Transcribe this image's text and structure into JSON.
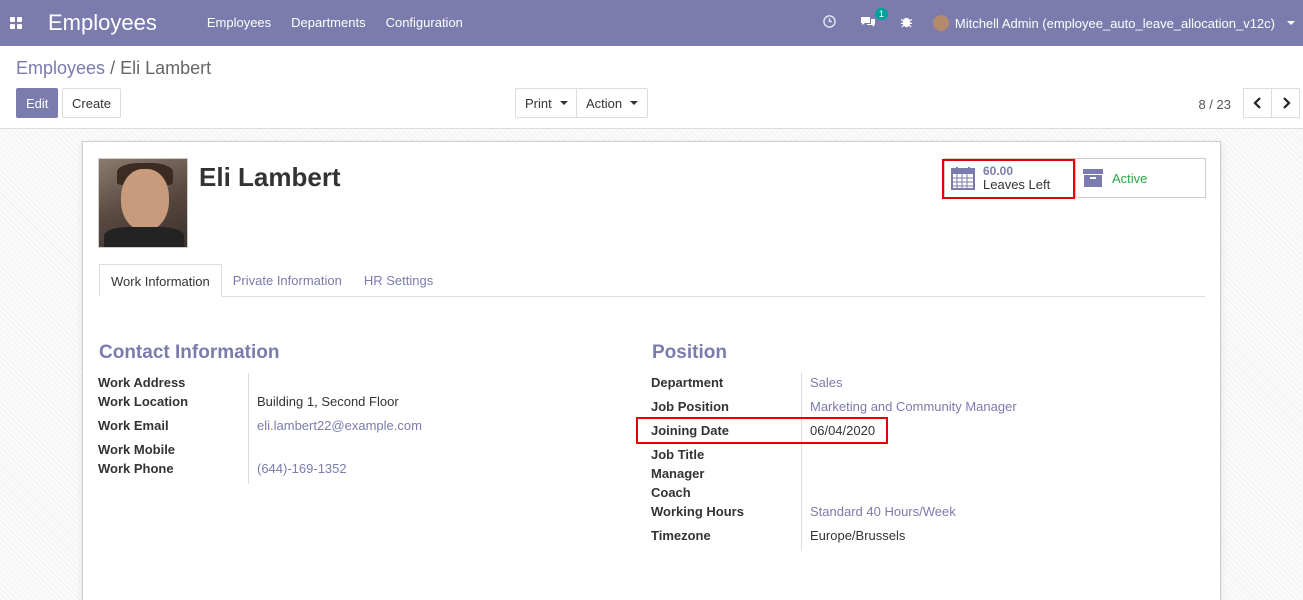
{
  "navbar": {
    "app_title": "Employees",
    "menu": [
      "Employees",
      "Departments",
      "Configuration"
    ],
    "message_count": "1",
    "user": "Mitchell Admin (employee_auto_leave_allocation_v12c)"
  },
  "control": {
    "breadcrumb_parent": "Employees",
    "breadcrumb_sep": "/",
    "breadcrumb_current": "Eli Lambert",
    "edit": "Edit",
    "create": "Create",
    "print": "Print",
    "action": "Action",
    "pager": "8 / 23"
  },
  "employee": {
    "name": "Eli Lambert"
  },
  "smart_buttons": {
    "leaves_value": "60.00",
    "leaves_label": "Leaves Left",
    "active_label": "Active"
  },
  "tabs": [
    "Work Information",
    "Private Information",
    "HR Settings"
  ],
  "contact": {
    "title": "Contact Information",
    "labels": {
      "work_address": "Work Address",
      "work_location": "Work Location",
      "work_email": "Work Email",
      "work_mobile": "Work Mobile",
      "work_phone": "Work Phone"
    },
    "values": {
      "work_location": "Building 1, Second Floor",
      "work_email": "eli.lambert22@example.com",
      "work_phone": "(644)-169-1352"
    }
  },
  "position": {
    "title": "Position",
    "labels": {
      "department": "Department",
      "job_position": "Job Position",
      "joining_date": "Joining Date",
      "job_title": "Job Title",
      "manager": "Manager",
      "coach": "Coach",
      "working_hours": "Working Hours",
      "timezone": "Timezone"
    },
    "values": {
      "department": "Sales",
      "job_position": "Marketing and Community Manager",
      "joining_date": "06/04/2020",
      "working_hours": "Standard 40 Hours/Week",
      "timezone": "Europe/Brussels"
    }
  },
  "colors": {
    "brand": "#7c7bad",
    "highlight": "#e60000",
    "active": "#28a745"
  }
}
